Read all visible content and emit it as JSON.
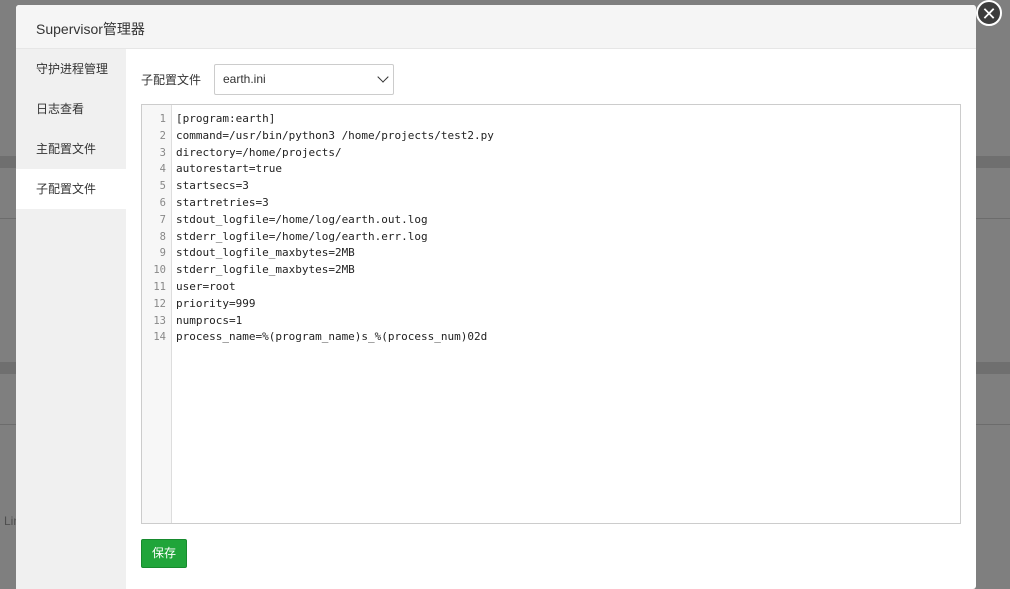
{
  "modal": {
    "title": "Supervisor管理器",
    "close_icon": "close-icon"
  },
  "sidebar": {
    "items": [
      {
        "label": "守护进程管理"
      },
      {
        "label": "日志查看"
      },
      {
        "label": "主配置文件"
      },
      {
        "label": "子配置文件"
      }
    ],
    "active_index": 3
  },
  "content": {
    "config_label": "子配置文件",
    "config_select": {
      "value": "earth.ini"
    },
    "editor": {
      "lines": [
        {
          "n": "1",
          "text": "[program:earth]"
        },
        {
          "n": "2",
          "text": "command=/usr/bin/python3 /home/projects/test2.py"
        },
        {
          "n": "3",
          "text": "directory=/home/projects/"
        },
        {
          "n": "4",
          "text": "autorestart=true"
        },
        {
          "n": "5",
          "text": "startsecs=3"
        },
        {
          "n": "6",
          "text": "startretries=3"
        },
        {
          "n": "7",
          "text": "stdout_logfile=/home/log/earth.out.log"
        },
        {
          "n": "8",
          "text": "stderr_logfile=/home/log/earth.err.log"
        },
        {
          "n": "9",
          "text": "stdout_logfile_maxbytes=2MB"
        },
        {
          "n": "10",
          "text": "stderr_logfile_maxbytes=2MB"
        },
        {
          "n": "11",
          "text": "user=root"
        },
        {
          "n": "12",
          "text": "priority=999"
        },
        {
          "n": "13",
          "text": "numprocs=1"
        },
        {
          "n": "14",
          "text": "process_name=%(program_name)s_%(process_num)02d"
        }
      ]
    },
    "save_label": "保存"
  },
  "background": {
    "label": "Lin"
  },
  "colors": {
    "accent": "#20a53a",
    "overlay": "#7f7f7f"
  }
}
